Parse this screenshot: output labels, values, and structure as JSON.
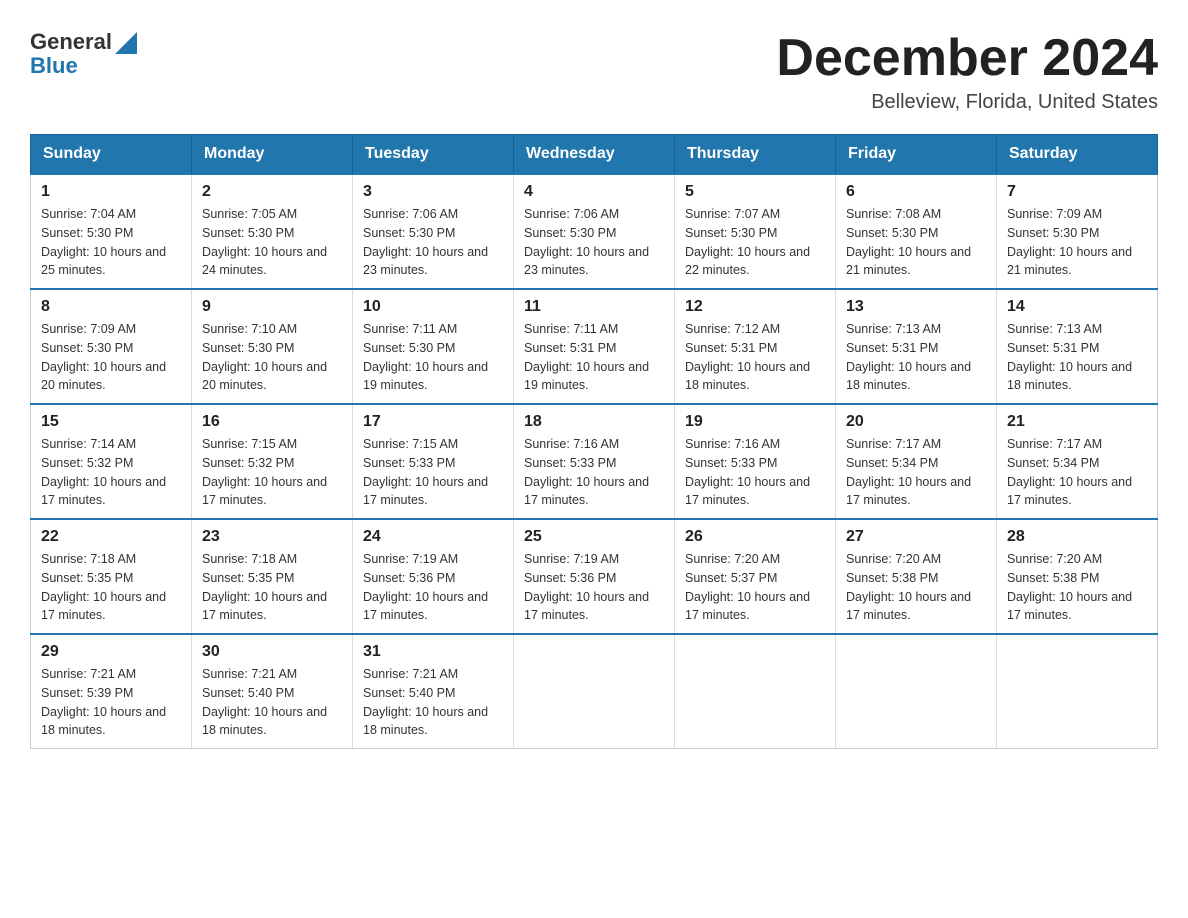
{
  "header": {
    "logo_text_part1": "General",
    "logo_text_part2": "Blue",
    "month_title": "December 2024",
    "location": "Belleview, Florida, United States"
  },
  "days_of_week": [
    "Sunday",
    "Monday",
    "Tuesday",
    "Wednesday",
    "Thursday",
    "Friday",
    "Saturday"
  ],
  "weeks": [
    [
      {
        "day": "1",
        "sunrise": "7:04 AM",
        "sunset": "5:30 PM",
        "daylight": "10 hours and 25 minutes."
      },
      {
        "day": "2",
        "sunrise": "7:05 AM",
        "sunset": "5:30 PM",
        "daylight": "10 hours and 24 minutes."
      },
      {
        "day": "3",
        "sunrise": "7:06 AM",
        "sunset": "5:30 PM",
        "daylight": "10 hours and 23 minutes."
      },
      {
        "day": "4",
        "sunrise": "7:06 AM",
        "sunset": "5:30 PM",
        "daylight": "10 hours and 23 minutes."
      },
      {
        "day": "5",
        "sunrise": "7:07 AM",
        "sunset": "5:30 PM",
        "daylight": "10 hours and 22 minutes."
      },
      {
        "day": "6",
        "sunrise": "7:08 AM",
        "sunset": "5:30 PM",
        "daylight": "10 hours and 21 minutes."
      },
      {
        "day": "7",
        "sunrise": "7:09 AM",
        "sunset": "5:30 PM",
        "daylight": "10 hours and 21 minutes."
      }
    ],
    [
      {
        "day": "8",
        "sunrise": "7:09 AM",
        "sunset": "5:30 PM",
        "daylight": "10 hours and 20 minutes."
      },
      {
        "day": "9",
        "sunrise": "7:10 AM",
        "sunset": "5:30 PM",
        "daylight": "10 hours and 20 minutes."
      },
      {
        "day": "10",
        "sunrise": "7:11 AM",
        "sunset": "5:30 PM",
        "daylight": "10 hours and 19 minutes."
      },
      {
        "day": "11",
        "sunrise": "7:11 AM",
        "sunset": "5:31 PM",
        "daylight": "10 hours and 19 minutes."
      },
      {
        "day": "12",
        "sunrise": "7:12 AM",
        "sunset": "5:31 PM",
        "daylight": "10 hours and 18 minutes."
      },
      {
        "day": "13",
        "sunrise": "7:13 AM",
        "sunset": "5:31 PM",
        "daylight": "10 hours and 18 minutes."
      },
      {
        "day": "14",
        "sunrise": "7:13 AM",
        "sunset": "5:31 PM",
        "daylight": "10 hours and 18 minutes."
      }
    ],
    [
      {
        "day": "15",
        "sunrise": "7:14 AM",
        "sunset": "5:32 PM",
        "daylight": "10 hours and 17 minutes."
      },
      {
        "day": "16",
        "sunrise": "7:15 AM",
        "sunset": "5:32 PM",
        "daylight": "10 hours and 17 minutes."
      },
      {
        "day": "17",
        "sunrise": "7:15 AM",
        "sunset": "5:33 PM",
        "daylight": "10 hours and 17 minutes."
      },
      {
        "day": "18",
        "sunrise": "7:16 AM",
        "sunset": "5:33 PM",
        "daylight": "10 hours and 17 minutes."
      },
      {
        "day": "19",
        "sunrise": "7:16 AM",
        "sunset": "5:33 PM",
        "daylight": "10 hours and 17 minutes."
      },
      {
        "day": "20",
        "sunrise": "7:17 AM",
        "sunset": "5:34 PM",
        "daylight": "10 hours and 17 minutes."
      },
      {
        "day": "21",
        "sunrise": "7:17 AM",
        "sunset": "5:34 PM",
        "daylight": "10 hours and 17 minutes."
      }
    ],
    [
      {
        "day": "22",
        "sunrise": "7:18 AM",
        "sunset": "5:35 PM",
        "daylight": "10 hours and 17 minutes."
      },
      {
        "day": "23",
        "sunrise": "7:18 AM",
        "sunset": "5:35 PM",
        "daylight": "10 hours and 17 minutes."
      },
      {
        "day": "24",
        "sunrise": "7:19 AM",
        "sunset": "5:36 PM",
        "daylight": "10 hours and 17 minutes."
      },
      {
        "day": "25",
        "sunrise": "7:19 AM",
        "sunset": "5:36 PM",
        "daylight": "10 hours and 17 minutes."
      },
      {
        "day": "26",
        "sunrise": "7:20 AM",
        "sunset": "5:37 PM",
        "daylight": "10 hours and 17 minutes."
      },
      {
        "day": "27",
        "sunrise": "7:20 AM",
        "sunset": "5:38 PM",
        "daylight": "10 hours and 17 minutes."
      },
      {
        "day": "28",
        "sunrise": "7:20 AM",
        "sunset": "5:38 PM",
        "daylight": "10 hours and 17 minutes."
      }
    ],
    [
      {
        "day": "29",
        "sunrise": "7:21 AM",
        "sunset": "5:39 PM",
        "daylight": "10 hours and 18 minutes."
      },
      {
        "day": "30",
        "sunrise": "7:21 AM",
        "sunset": "5:40 PM",
        "daylight": "10 hours and 18 minutes."
      },
      {
        "day": "31",
        "sunrise": "7:21 AM",
        "sunset": "5:40 PM",
        "daylight": "10 hours and 18 minutes."
      },
      null,
      null,
      null,
      null
    ]
  ]
}
